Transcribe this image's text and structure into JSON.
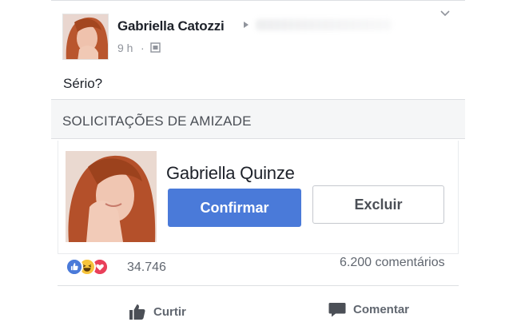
{
  "post": {
    "author": "Gabriella Catozzi",
    "timestamp": "9 h",
    "separator": "·",
    "text": "Sério?"
  },
  "friend_requests": {
    "title": "SOLICITAÇÕES DE AMIZADE",
    "name": "Gabriella Quinze",
    "confirm_label": "Confirmar",
    "delete_label": "Excluir"
  },
  "stats": {
    "reaction_count": "34.746",
    "comment_count": "6.200 comentários"
  },
  "actions": {
    "like_label": "Curtir",
    "comment_label": "Comentar"
  },
  "icons": [
    "avatar",
    "arrow-right-icon",
    "chevron-down-icon",
    "globe-icon",
    "like-reaction-icon",
    "haha-reaction-icon",
    "love-reaction-icon",
    "thumbs-up-icon",
    "comment-icon"
  ],
  "colors": {
    "accent": "#4a7ad9",
    "love": "#e9405a",
    "haha": "#f7c43b",
    "muted": "#90949c"
  }
}
